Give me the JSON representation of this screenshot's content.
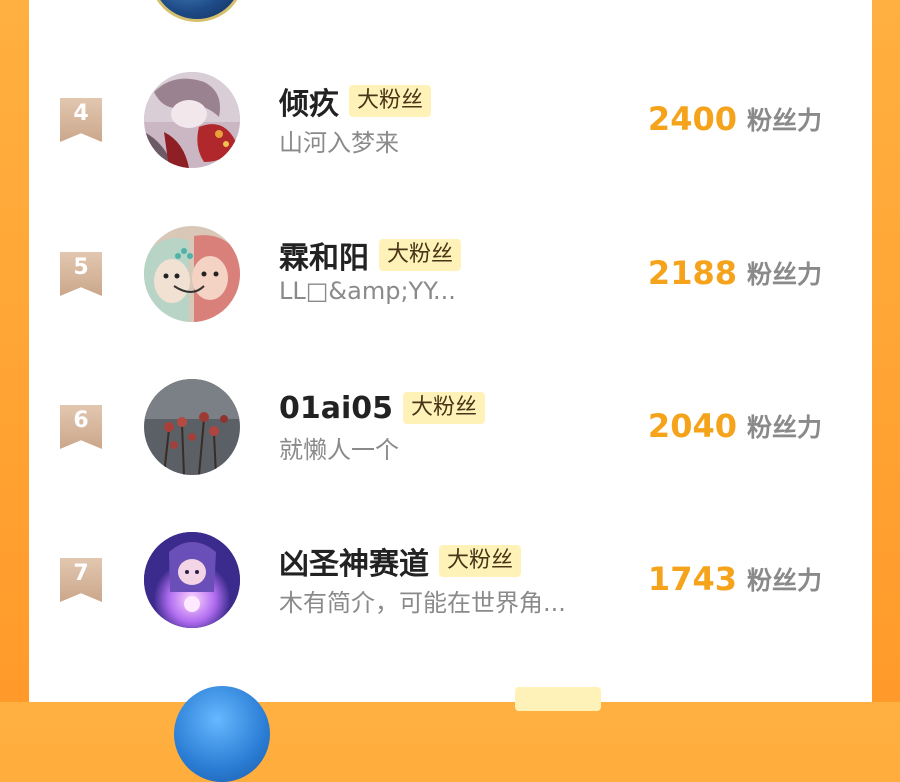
{
  "leaderboard": {
    "score_unit": "粉丝力",
    "badge_label": "大粉丝",
    "entries": [
      {
        "rank": "4",
        "name": "倾疚",
        "bio": "山河入梦来",
        "score": "2400",
        "avatar": "girl-art-avatar"
      },
      {
        "rank": "5",
        "name": "霖和阳",
        "bio": "LL□&amp;YY...",
        "score": "2188",
        "avatar": "couple-art-avatar"
      },
      {
        "rank": "6",
        "name": "01ai05",
        "bio": "就懒人一个",
        "score": "2040",
        "avatar": "roses-avatar"
      },
      {
        "rank": "7",
        "name": "凶圣神赛道",
        "bio": "木有简介，可能在世界角...",
        "score": "1743",
        "avatar": "glowing-character-avatar"
      }
    ]
  },
  "colors": {
    "background_orange": "#ff9f2e",
    "panel": "#ffffff",
    "score": "#f5a31b",
    "badge_bg": "#fff2b8",
    "rank_flag": "#d2b296"
  }
}
